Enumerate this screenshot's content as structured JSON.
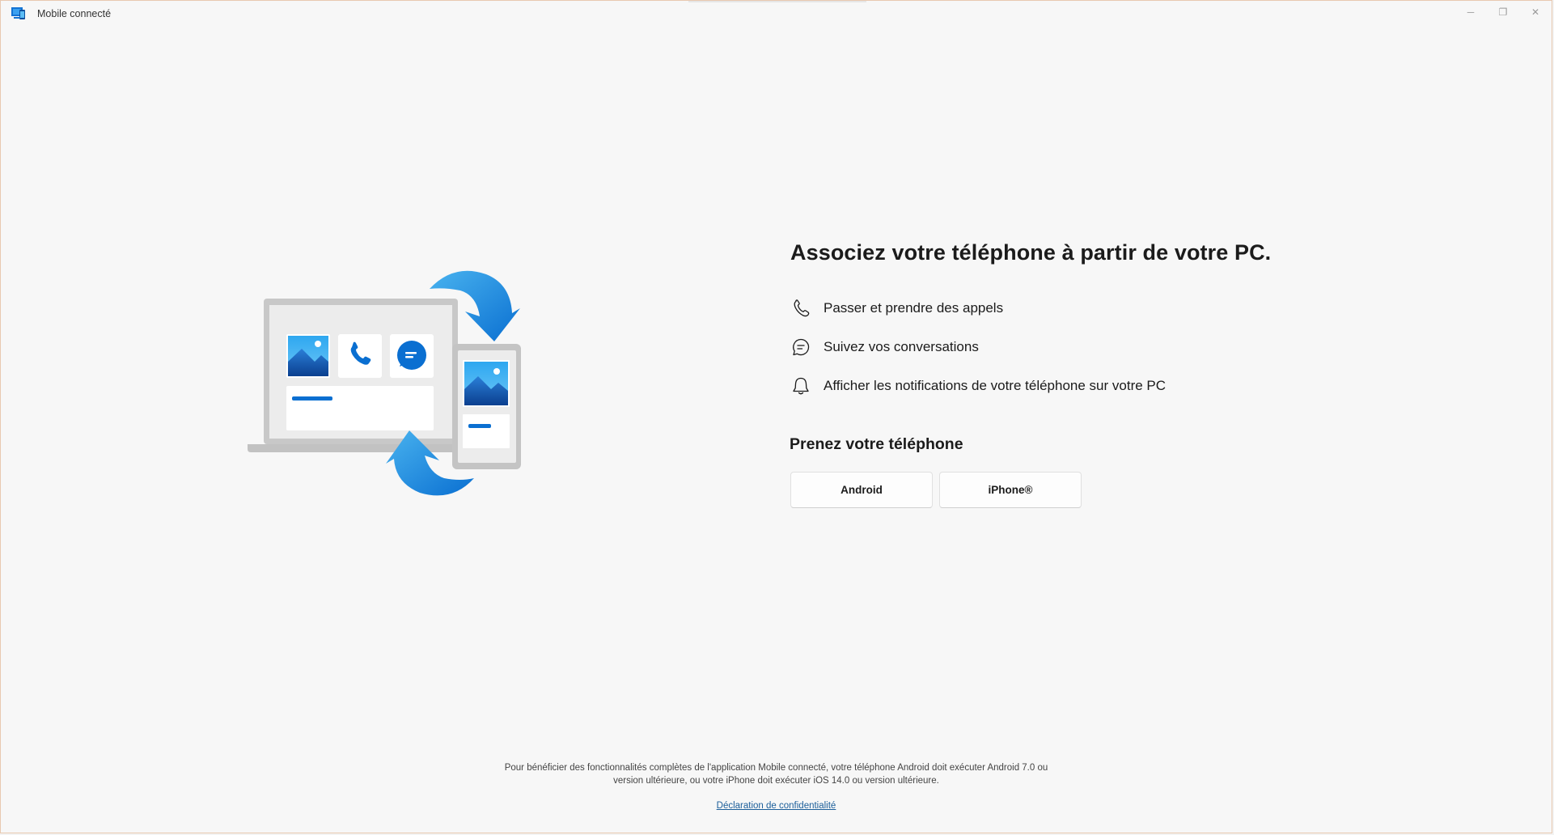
{
  "window": {
    "title": "Mobile connecté",
    "minimize_symbol": "─",
    "maximize_symbol": "❐",
    "close_symbol": "✕"
  },
  "main": {
    "headline": "Associez votre téléphone à partir de votre PC.",
    "features": [
      {
        "icon": "phone-icon",
        "label": "Passer et prendre des appels"
      },
      {
        "icon": "chat-icon",
        "label": "Suivez vos conversations"
      },
      {
        "icon": "bell-icon",
        "label": "Afficher les notifications de votre téléphone sur votre PC"
      }
    ],
    "subhead": "Prenez votre téléphone",
    "buttons": {
      "android": "Android",
      "iphone": "iPhone®"
    }
  },
  "footer": {
    "requirement_line1": "Pour bénéficier des fonctionnalités complètes de l'application Mobile connecté, votre téléphone Android doit exécuter Android 7.0 ou",
    "requirement_line2": "version ultérieure, ou votre iPhone doit exécuter iOS 14.0 ou version ultérieure.",
    "privacy_link": "Déclaration de confidentialité"
  },
  "colors": {
    "accent": "#0a6fd1",
    "background": "#f7f7f7",
    "link": "#1b5e9a"
  }
}
